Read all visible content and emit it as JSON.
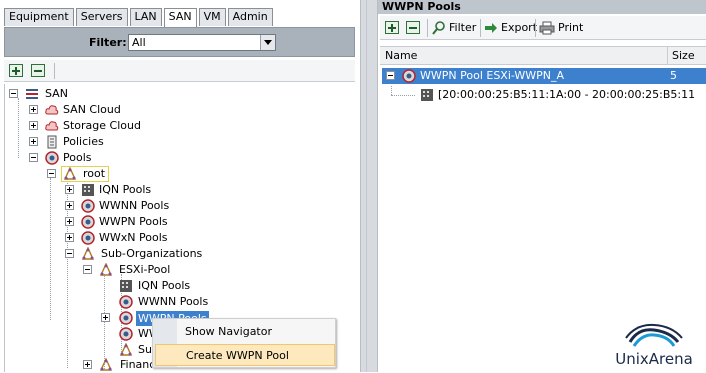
{
  "tabs": [
    {
      "label": "Equipment"
    },
    {
      "label": "Servers"
    },
    {
      "label": "LAN"
    },
    {
      "label": "SAN"
    },
    {
      "label": "VM"
    },
    {
      "label": "Admin"
    }
  ],
  "active_tab": "SAN",
  "filter": {
    "label": "Filter:",
    "value": "All"
  },
  "tree": {
    "san": "SAN",
    "san_cloud": "SAN Cloud",
    "storage_cloud": "Storage Cloud",
    "policies": "Policies",
    "pools": "Pools",
    "root": "root",
    "iqn_pools": "IQN Pools",
    "wwnn_pools": "WWNN Pools",
    "wwpn_pools": "WWPN Pools",
    "wwxn_pools": "WWxN Pools",
    "sub_orgs": "Sub-Organizations",
    "esxi_pool": "ESXi-Pool",
    "esxi_iqn": "IQN Pools",
    "esxi_wwnn": "WWNN Pools",
    "esxi_wwpn": "WWPN Pools",
    "esxi_wwxn": "WW",
    "esxi_sub": "Su",
    "finance": "Financ"
  },
  "context_menu": {
    "items": [
      {
        "label": "Show Navigator"
      },
      {
        "label": "Create WWPN Pool"
      }
    ]
  },
  "right": {
    "title": "WWPN Pools",
    "toolbar": {
      "filter": "Filter",
      "export": "Export",
      "print": "Print"
    },
    "columns": {
      "name": "Name",
      "size": "Size"
    },
    "rows": [
      {
        "name": "WWPN Pool ESXi-WWPN_A",
        "size": "5"
      },
      {
        "name": "[20:00:00:25:B5:11:1A:00 - 20:00:00:25:B5:11",
        "size": ""
      }
    ]
  },
  "logo": {
    "text": "UnixArena"
  },
  "colors": {
    "selection": "#3d80cd",
    "menu_hover": "#fde9bd",
    "filter_bar": "#a9b1bb"
  }
}
